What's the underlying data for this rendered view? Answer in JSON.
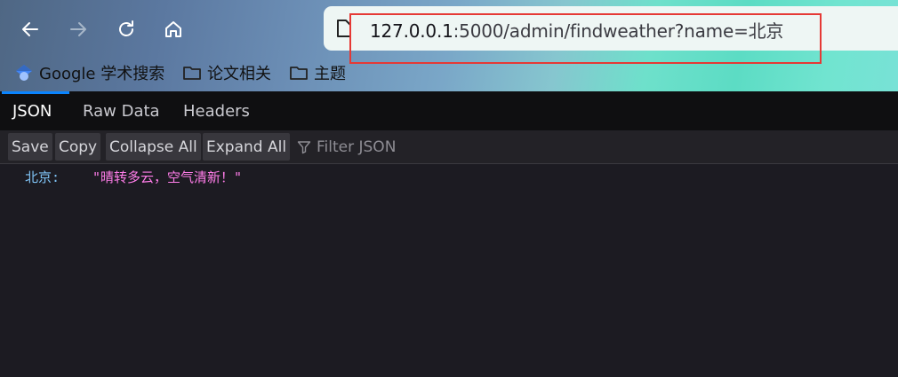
{
  "browser": {
    "url_host": "127.0.0.1",
    "url_rest": ":5000/admin/findweather?name=北京",
    "bookmarks": [
      {
        "label": "Google 学术搜索",
        "icon": "scholar-icon"
      },
      {
        "label": "论文相关",
        "icon": "folder-icon"
      },
      {
        "label": "主题",
        "icon": "folder-icon"
      }
    ],
    "nav_icons": [
      "back-arrow-icon",
      "forward-arrow-icon",
      "reload-icon",
      "home-icon"
    ]
  },
  "viewer": {
    "tabs": [
      {
        "label": "JSON",
        "active": true
      },
      {
        "label": "Raw Data",
        "active": false
      },
      {
        "label": "Headers",
        "active": false
      }
    ],
    "toolbar": {
      "save": "Save",
      "copy": "Copy",
      "collapse_all": "Collapse All",
      "expand_all": "Expand All",
      "filter_placeholder": "Filter JSON"
    },
    "json": {
      "key": "北京:",
      "value": "\"晴转多云，空气清新！\""
    }
  },
  "colors": {
    "json_key": "#7fc3f5",
    "json_string": "#ff7de9",
    "active_tab_underline": "#0a84ff",
    "highlight_box": "#e53935"
  }
}
